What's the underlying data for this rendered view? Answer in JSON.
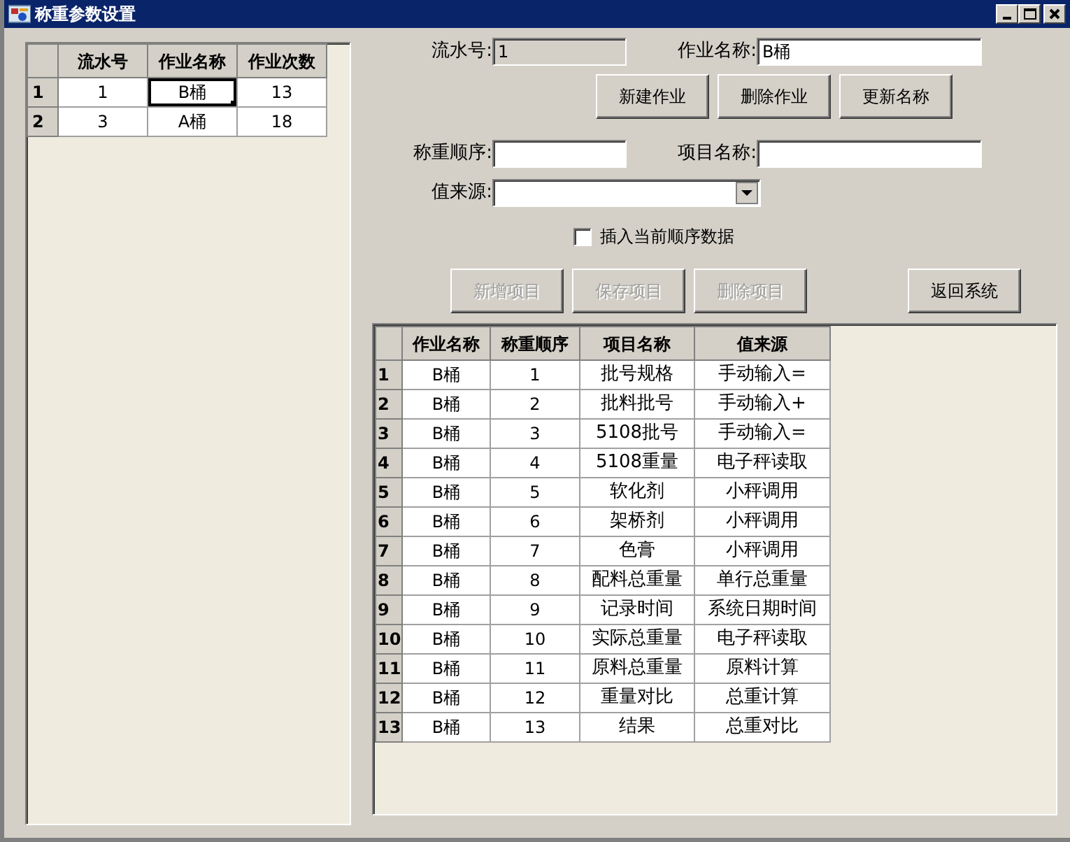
{
  "window": {
    "title": "称重参数设置",
    "controls": [
      {
        "kind": "minimize"
      },
      {
        "kind": "maximize"
      },
      {
        "kind": "close"
      }
    ]
  },
  "jobs_table": {
    "columns": [
      "流水号",
      "作业名称",
      "作业次数"
    ],
    "rows": [
      {
        "header": "1",
        "cells": [
          {
            "text": "1",
            "focused": false
          },
          {
            "text": "B桶",
            "focused": true
          },
          {
            "text": "13",
            "focused": false
          }
        ]
      },
      {
        "header": "2",
        "cells": [
          {
            "text": "3",
            "focused": false
          },
          {
            "text": "A桶",
            "focused": false
          },
          {
            "text": "18",
            "focused": false
          }
        ]
      }
    ]
  },
  "job_form": {
    "serial_label": "流水号:",
    "serial_value": "1",
    "serial_disabled": true,
    "name_label": "作业名称:",
    "name_value": "B桶"
  },
  "job_buttons": [
    {
      "label": "新建作业",
      "disabled": false
    },
    {
      "label": "删除作业",
      "disabled": false
    },
    {
      "label": "更新名称",
      "disabled": false
    }
  ],
  "item_form": {
    "order_label": "称重顺序:",
    "item_name_label": "项目名称:",
    "source_label": "值来源:"
  },
  "insert_checkbox": {
    "label": "插入当前顺序数据",
    "checked": false
  },
  "item_buttons": [
    {
      "label": "新增项目",
      "disabled": true
    },
    {
      "label": "保存项目",
      "disabled": true
    },
    {
      "label": "删除项目",
      "disabled": true
    }
  ],
  "return_button": {
    "label": "返回系统",
    "disabled": false
  },
  "items_table": {
    "columns": [
      "作业名称",
      "称重顺序",
      "项目名称",
      "值来源"
    ],
    "rows": [
      {
        "header": "1",
        "cells": [
          "B桶",
          "1",
          "批号规格",
          "手动输入="
        ]
      },
      {
        "header": "2",
        "cells": [
          "B桶",
          "2",
          "批料批号",
          "手动输入+"
        ]
      },
      {
        "header": "3",
        "cells": [
          "B桶",
          "3",
          "5108批号",
          "手动输入="
        ]
      },
      {
        "header": "4",
        "cells": [
          "B桶",
          "4",
          "5108重量",
          "电子秤读取"
        ]
      },
      {
        "header": "5",
        "cells": [
          "B桶",
          "5",
          "软化剂",
          "小秤调用"
        ]
      },
      {
        "header": "6",
        "cells": [
          "B桶",
          "6",
          "架桥剂",
          "小秤调用"
        ]
      },
      {
        "header": "7",
        "cells": [
          "B桶",
          "7",
          "色膏",
          "小秤调用"
        ]
      },
      {
        "header": "8",
        "cells": [
          "B桶",
          "8",
          "配料总重量",
          "单行总重量"
        ]
      },
      {
        "header": "9",
        "cells": [
          "B桶",
          "9",
          "记录时间",
          "系统日期时间"
        ]
      },
      {
        "header": "10",
        "cells": [
          "B桶",
          "10",
          "实际总重量",
          "电子秤读取"
        ]
      },
      {
        "header": "11",
        "cells": [
          "B桶",
          "11",
          "原料总重量",
          "原料计算"
        ]
      },
      {
        "header": "12",
        "cells": [
          "B桶",
          "12",
          "重量对比",
          "总重计算"
        ]
      },
      {
        "header": "13",
        "cells": [
          "B桶",
          "13",
          "结果",
          "总重对比"
        ]
      }
    ]
  }
}
